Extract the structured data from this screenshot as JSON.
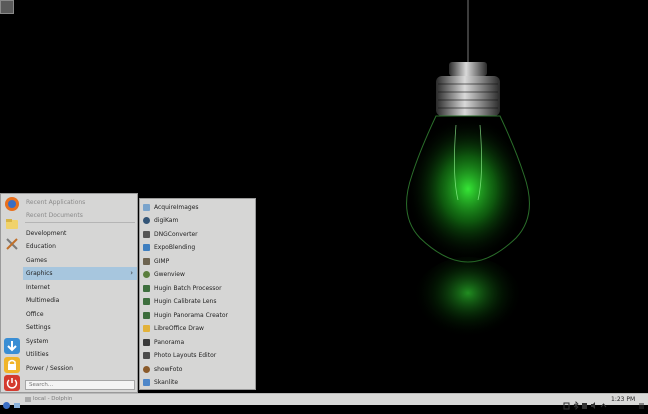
{
  "menu": {
    "recent_applications": "Recent Applications",
    "recent_documents": "Recent Documents",
    "categories": [
      {
        "label": "Development",
        "active": false
      },
      {
        "label": "Education",
        "active": false
      },
      {
        "label": "Games",
        "active": false
      },
      {
        "label": "Graphics",
        "active": true
      },
      {
        "label": "Internet",
        "active": false
      },
      {
        "label": "Multimedia",
        "active": false
      },
      {
        "label": "Office",
        "active": false
      },
      {
        "label": "Settings",
        "active": false
      },
      {
        "label": "System",
        "active": false
      },
      {
        "label": "Utilities",
        "active": false
      },
      {
        "label": "Power / Session",
        "active": false
      }
    ],
    "submenu_arrow": "›",
    "search_placeholder": "Search...",
    "favorites": [
      {
        "icon": "firefox-icon",
        "color": "#e8701e"
      },
      {
        "icon": "files-icon",
        "color": "#f0d26a"
      },
      {
        "icon": "tools-icon",
        "color": "#9a9a9a"
      },
      {
        "icon": "download-icon",
        "color": "#3a8ed4"
      },
      {
        "icon": "lock-icon",
        "color": "#f0b429"
      },
      {
        "icon": "power-icon",
        "color": "#d43a2e"
      }
    ]
  },
  "submenu": {
    "items": [
      {
        "label": "AcquireImages",
        "icon": "scanner-icon",
        "color": "#7aa4cc"
      },
      {
        "label": "digiKam",
        "icon": "digikam-icon",
        "color": "#335577"
      },
      {
        "label": "DNGConverter",
        "icon": "dng-icon",
        "color": "#555555"
      },
      {
        "label": "ExpoBlending",
        "icon": "expoblending-icon",
        "color": "#3f7fc0"
      },
      {
        "label": "GIMP",
        "icon": "gimp-icon",
        "color": "#6d6350"
      },
      {
        "label": "Gwenview",
        "icon": "gwenview-icon",
        "color": "#5b7e3e"
      },
      {
        "label": "Hugin Batch Processor",
        "icon": "hugin-batch-icon",
        "color": "#3d6e3d"
      },
      {
        "label": "Hugin Calibrate Lens",
        "icon": "hugin-lens-icon",
        "color": "#3d6e3d"
      },
      {
        "label": "Hugin Panorama Creator",
        "icon": "hugin-panorama-icon",
        "color": "#3d6e3d"
      },
      {
        "label": "LibreOffice Draw",
        "icon": "libreoffice-draw-icon",
        "color": "#e2b23a"
      },
      {
        "label": "Panorama",
        "icon": "panorama-icon",
        "color": "#3a3a3a"
      },
      {
        "label": "Photo Layouts Editor",
        "icon": "photo-layouts-icon",
        "color": "#4a4a4a"
      },
      {
        "label": "showFoto",
        "icon": "showfoto-icon",
        "color": "#8a5a2a"
      },
      {
        "label": "Skanlite",
        "icon": "skanlite-icon",
        "color": "#4d86c9"
      }
    ]
  },
  "taskbar": {
    "task_label": "local - Dolphin",
    "clock": "1:23 PM"
  }
}
